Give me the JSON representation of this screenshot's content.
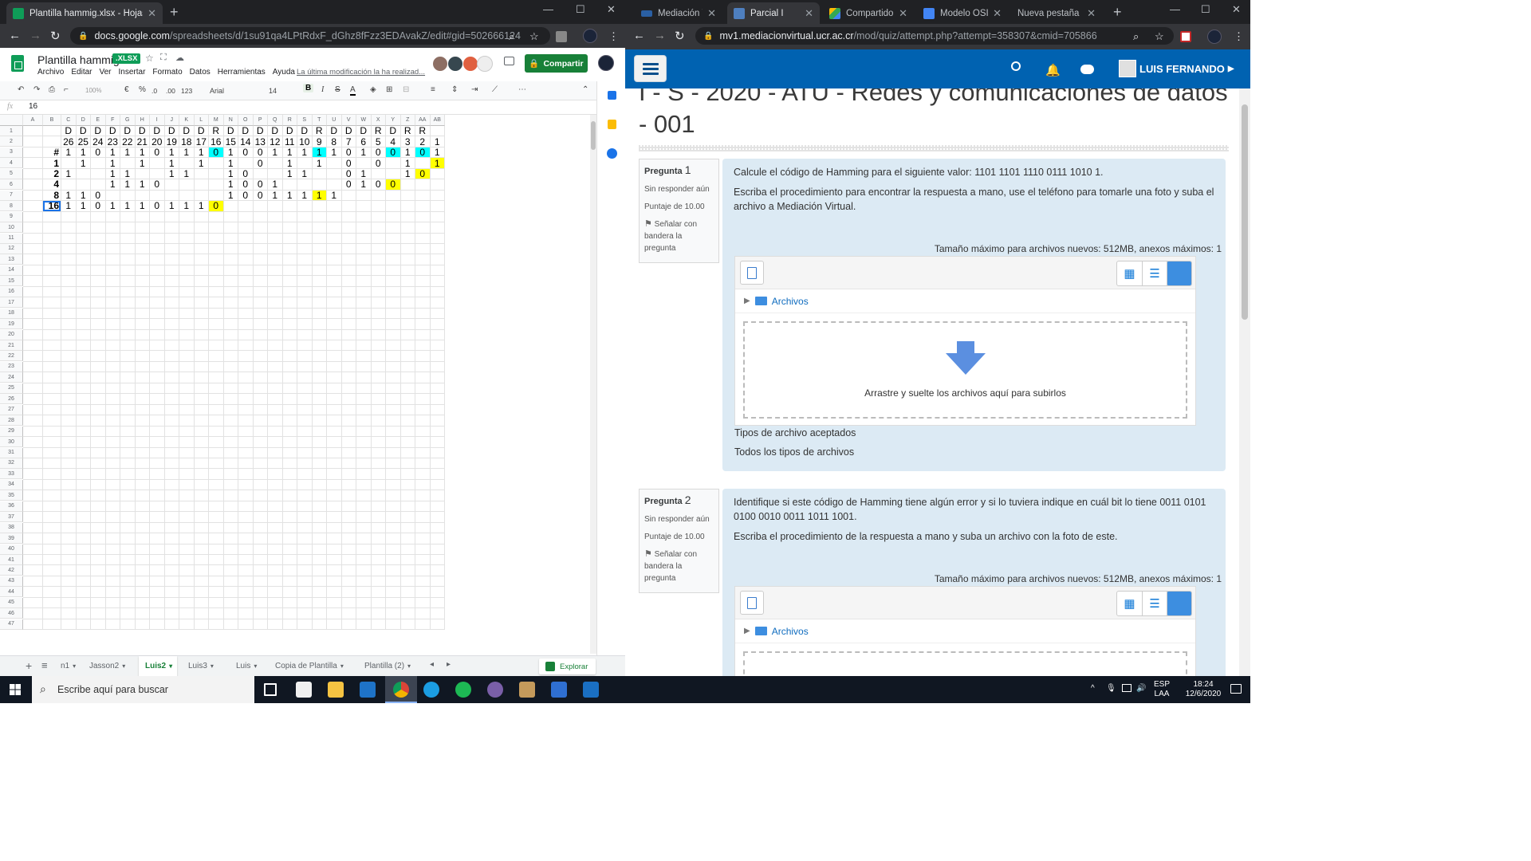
{
  "left_browser": {
    "tab_title": "Plantilla hammig.xlsx - Hojas de c",
    "url_host": "docs.google.com",
    "url_path": "/spreadsheets/d/1su91qa4LPtRdxF_dGhz8fFzz3EDAvakZ/edit#gid=502666124"
  },
  "sheets": {
    "doc_title": "Plantilla hammig",
    "badge": ".XLSX",
    "menu": [
      "Archivo",
      "Editar",
      "Ver",
      "Insertar",
      "Formato",
      "Datos",
      "Herramientas",
      "Ayuda"
    ],
    "last_modified": "La última modificación la ha realizad...",
    "share_label": "Compartir",
    "toolbar": {
      "zoom": "100%",
      "currency": "€",
      "percent": "%",
      "dec_less": ".0",
      "dec_more": ".00",
      "format": "123",
      "font": "Arial",
      "size": "14"
    },
    "formula_value": "16",
    "fx": "fx",
    "columns": [
      "A",
      "B",
      "C",
      "D",
      "E",
      "F",
      "G",
      "H",
      "I",
      "J",
      "K",
      "L",
      "M",
      "N",
      "O",
      "P",
      "Q",
      "R",
      "S",
      "T",
      "U",
      "V",
      "W",
      "X",
      "Y",
      "Z",
      "AA",
      "AB"
    ],
    "rows": [
      "1",
      "2",
      "3",
      "4",
      "5",
      "6",
      "7",
      "8",
      "9",
      "10",
      "11",
      "12",
      "13",
      "14",
      "15",
      "16",
      "17",
      "18",
      "19",
      "20",
      "21",
      "22",
      "23",
      "24",
      "25",
      "26",
      "27",
      "28",
      "29",
      "30",
      "31",
      "32",
      "33",
      "34",
      "35",
      "36",
      "37",
      "38",
      "39",
      "40",
      "41",
      "42",
      "43",
      "44",
      "45",
      "46",
      "47"
    ],
    "grid": [
      [
        "",
        "",
        "D",
        "D",
        "D",
        "D",
        "D",
        "D",
        "D",
        "D",
        "D",
        "D",
        "R",
        "D",
        "D",
        "D",
        "D",
        "D",
        "D",
        "R",
        "D",
        "D",
        "D",
        "R",
        "D",
        "R",
        "R"
      ],
      [
        "",
        "",
        "26",
        "25",
        "24",
        "23",
        "22",
        "21",
        "20",
        "19",
        "18",
        "17",
        "16",
        "15",
        "14",
        "13",
        "12",
        "11",
        "10",
        "9",
        "8",
        "7",
        "6",
        "5",
        "4",
        "3",
        "2",
        "1"
      ],
      [
        "",
        "#",
        "1",
        "1",
        "0",
        "1",
        "1",
        "1",
        "0",
        "1",
        "1",
        "1",
        "0",
        "1",
        "0",
        "0",
        "1",
        "1",
        "1",
        "1",
        "1",
        "0",
        "1",
        "0",
        "0",
        "1",
        "0",
        "1"
      ],
      [
        "",
        "1",
        "",
        "1",
        "",
        "1",
        "",
        "1",
        "",
        "1",
        "",
        "1",
        "",
        "1",
        "",
        "0",
        "",
        "1",
        "",
        "1",
        "",
        "0",
        "",
        "0",
        "",
        "1",
        "",
        "1"
      ],
      [
        "",
        "2",
        "1",
        "",
        "",
        "1",
        "1",
        "",
        "",
        "1",
        "1",
        "",
        "",
        "1",
        "0",
        "",
        "",
        "1",
        "1",
        "",
        "",
        "0",
        "1",
        "",
        "",
        "1",
        "0",
        ""
      ],
      [
        "",
        "4",
        "",
        "",
        "",
        "1",
        "1",
        "1",
        "0",
        "",
        "",
        "",
        "",
        "1",
        "0",
        "0",
        "1",
        "",
        "",
        "",
        "",
        "0",
        "1",
        "0",
        "0",
        "",
        "",
        ""
      ],
      [
        "",
        "8",
        "1",
        "1",
        "0",
        "",
        "",
        "",
        "",
        "",
        "",
        "",
        "",
        "1",
        "0",
        "0",
        "1",
        "1",
        "1",
        "1",
        "1",
        "",
        "",
        "",
        "",
        "",
        "",
        ""
      ],
      [
        "",
        "16",
        "1",
        "1",
        "0",
        "1",
        "1",
        "1",
        "0",
        "1",
        "1",
        "1",
        "0",
        "",
        "",
        "",
        "",
        "",
        "",
        "",
        "",
        "",
        "",
        "",
        "",
        "",
        "",
        ""
      ]
    ],
    "highlights": {
      "cyan": [
        "3:12",
        "3:19",
        "3:24",
        "3:26"
      ],
      "yellow": [
        "4:27",
        "5:26",
        "6:24",
        "7:19",
        "8:12"
      ]
    },
    "sheet_tabs": [
      "n1",
      "Jasson2",
      "Luis2",
      "Luis3",
      "Luis",
      "Copia de Plantilla",
      "Plantilla (2)"
    ],
    "active_tab": "Luis2",
    "explore_label": "Explorar"
  },
  "right_browser": {
    "tabs": [
      {
        "title": "Mediación Virtu",
        "active": false
      },
      {
        "title": "Parcial I",
        "active": true
      },
      {
        "title": "Compartido co",
        "active": false
      },
      {
        "title": "Modelo OSI - D",
        "active": false
      },
      {
        "title": "Nueva pestaña",
        "active": false
      }
    ],
    "url_host": "mv1.mediacionvirtual.ucr.ac.cr",
    "url_path": "/mod/quiz/attempt.php?attempt=358307&cmid=705866"
  },
  "quiz": {
    "user_name": "LUIS FERNANDO",
    "course_title": "I - S - 2020 - ATU - Redes y comunicaciones de datos - 001",
    "questions": [
      {
        "label": "Pregunta",
        "number": "1",
        "status": "Sin responder aún",
        "points": "Puntaje de 10.00",
        "flag": "Señalar con bandera la pregunta",
        "text1": "Calcule el código de Hamming para el siguiente valor: 1101 1101 1110 0111 1010 1.",
        "text2": "Escriba el procedimiento para encontrar la respuesta a mano, use el teléfono para tomarle una foto y suba el archivo a Mediación Virtual.",
        "max_size": "Tamaño máximo para archivos nuevos: 512MB, anexos máximos: 1",
        "folder": "Archivos",
        "drop": "Arrastre y suelte los archivos aquí para subirlos",
        "types_label": "Tipos de archivo aceptados",
        "types_value": "Todos los tipos de archivos"
      },
      {
        "label": "Pregunta",
        "number": "2",
        "status": "Sin responder aún",
        "points": "Puntaje de 10.00",
        "flag": "Señalar con bandera la pregunta",
        "text1": "Identifique si este código de Hamming tiene algún error y si lo tuviera indique en cuál bit lo tiene 0011 0101 0100 0010 0011 1011 1001.",
        "text2": "Escriba el procedimiento de la respuesta a mano y suba un archivo con la foto de este.",
        "max_size": "Tamaño máximo para archivos nuevos: 512MB, anexos máximos: 1",
        "folder": "Archivos"
      }
    ]
  },
  "taskbar": {
    "search_placeholder": "Escribe aquí para buscar",
    "lang": "ESP",
    "region": "LAA",
    "time": "18:24",
    "date": "12/6/2020"
  }
}
